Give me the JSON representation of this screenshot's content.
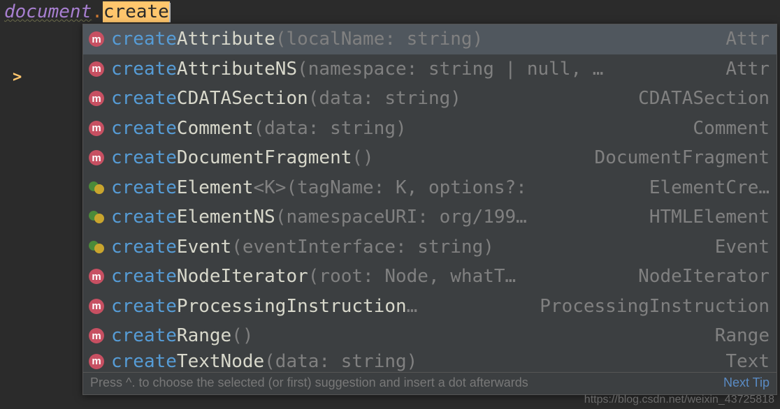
{
  "code": {
    "object": "document",
    "dot": ".",
    "typed": "create"
  },
  "gutter_arrow": ">",
  "suggestions": [
    {
      "icon": "m",
      "match": "create",
      "name": "Attribute",
      "params": "(localName: string)",
      "ret": "Attr",
      "selected": true
    },
    {
      "icon": "m",
      "match": "create",
      "name": "AttributeNS",
      "params": "(namespace: string | null, …",
      "ret": "Attr"
    },
    {
      "icon": "m",
      "match": "create",
      "name": "CDATASection",
      "params": "(data: string)",
      "ret": "CDATASection"
    },
    {
      "icon": "m",
      "match": "create",
      "name": "Comment",
      "params": "(data: string)",
      "ret": "Comment"
    },
    {
      "icon": "m",
      "match": "create",
      "name": "DocumentFragment",
      "params": "()",
      "ret": "DocumentFragment"
    },
    {
      "icon": "multi",
      "match": "create",
      "name": "Element",
      "params": "<K>(tagName: K, options?:",
      "ret": "ElementCre…"
    },
    {
      "icon": "multi",
      "match": "create",
      "name": "ElementNS",
      "params": "(namespaceURI: org/199…",
      "ret": "HTMLElement"
    },
    {
      "icon": "multi",
      "match": "create",
      "name": "Event",
      "params": "(eventInterface: string)",
      "ret": "Event"
    },
    {
      "icon": "m",
      "match": "create",
      "name": "NodeIterator",
      "params": "(root: Node, whatT…",
      "ret": "NodeIterator"
    },
    {
      "icon": "m",
      "match": "create",
      "name": "ProcessingInstruction",
      "params": "…",
      "ret": "ProcessingInstruction"
    },
    {
      "icon": "m",
      "match": "create",
      "name": "Range",
      "params": "()",
      "ret": "Range"
    },
    {
      "icon": "m",
      "match": "create",
      "name": "TextNode",
      "params": "(data: string)",
      "ret": "Text",
      "partial": true
    }
  ],
  "hint": {
    "text": "Press ^. to choose the selected (or first) suggestion and insert a dot afterwards",
    "link": "Next Tip"
  },
  "watermark": "https://blog.csdn.net/weixin_43725818"
}
